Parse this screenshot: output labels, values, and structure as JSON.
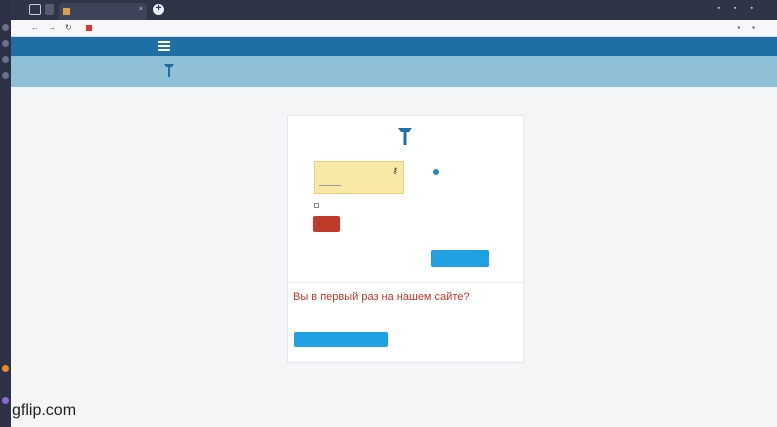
{
  "browser": {
    "tab_title": "",
    "tab_close": "×",
    "new_tab": "+",
    "url": "",
    "page_title": ""
  },
  "site": {
    "header_login_link": "",
    "banner_link": ""
  },
  "login": {
    "username_value": "",
    "remember_label": "",
    "login_button": "",
    "forgot_link": "",
    "cookies_note": "",
    "guest_note": "",
    "guest_button": ""
  },
  "signup": {
    "title": "Вы в первый раз на нашем сайте?",
    "text": "",
    "create_button": ""
  },
  "watermark": "gflip.com",
  "colors": {
    "header": "#1e6fa6",
    "banner": "#8fc0d8",
    "login_button": "#c0392b",
    "action_button": "#1fa0e3",
    "autofill": "#f9e9a6"
  }
}
